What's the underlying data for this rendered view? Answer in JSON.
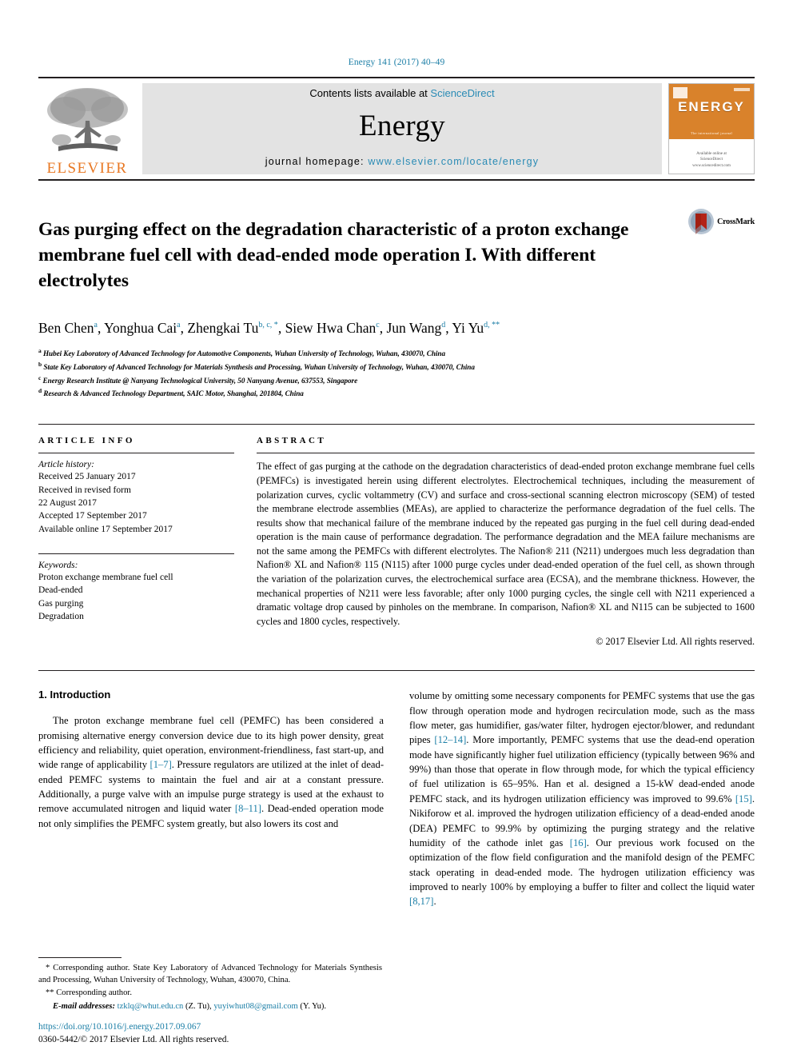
{
  "running_head": "Energy 141 (2017) 40–49",
  "masthead": {
    "publisher_name": "ELSEVIER",
    "contents_text": "Contents lists available at ",
    "sciencedirect": "ScienceDirect",
    "journal_title": "Energy",
    "homepage_label": "journal homepage: ",
    "homepage_url": "www.elsevier.com/locate/energy",
    "cover_title": "ENERGY",
    "cover_tagline": "The international journal",
    "cover_footer_1": "Available online at",
    "cover_footer_2": "ScienceDirect",
    "cover_footer_3": "www.sciencedirect.com",
    "link_color": "#2a8bb5",
    "brand_orange": "#e87722"
  },
  "article": {
    "title": "Gas purging effect on the degradation characteristic of a proton exchange membrane fuel cell with dead-ended mode operation I. With different electrolytes",
    "crossmark_label": "CrossMark",
    "authors": [
      {
        "name": "Ben Chen",
        "sup": "a",
        "sep": ", "
      },
      {
        "name": "Yonghua Cai",
        "sup": "a",
        "sep": ", "
      },
      {
        "name": "Zhengkai Tu",
        "sup": "b, c, *",
        "sep": ", "
      },
      {
        "name": "Siew Hwa Chan",
        "sup": "c",
        "sep": ", "
      },
      {
        "name": "Jun Wang",
        "sup": "d",
        "sep": ", "
      },
      {
        "name": "Yi Yu",
        "sup": "d, **",
        "sep": ""
      }
    ],
    "affiliations": [
      {
        "sup": "a",
        "text": "Hubei Key Laboratory of Advanced Technology for Automotive Components, Wuhan University of Technology, Wuhan, 430070, China"
      },
      {
        "sup": "b",
        "text": "State Key Laboratory of Advanced Technology for Materials Synthesis and Processing, Wuhan University of Technology, Wuhan, 430070, China"
      },
      {
        "sup": "c",
        "text": "Energy Research Institute @ Nanyang Technological University, 50 Nanyang Avenue, 637553, Singapore"
      },
      {
        "sup": "d",
        "text": "Research & Advanced Technology Department, SAIC Motor, Shanghai, 201804, China"
      }
    ]
  },
  "article_info": {
    "label": "ARTICLE INFO",
    "history_title": "Article history:",
    "history": [
      "Received 25 January 2017",
      "Received in revised form",
      "22 August 2017",
      "Accepted 17 September 2017",
      "Available online 17 September 2017"
    ],
    "keywords_title": "Keywords:",
    "keywords": [
      "Proton exchange membrane fuel cell",
      "Dead-ended",
      "Gas purging",
      "Degradation"
    ]
  },
  "abstract": {
    "label": "ABSTRACT",
    "text": "The effect of gas purging at the cathode on the degradation characteristics of dead-ended proton exchange membrane fuel cells (PEMFCs) is investigated herein using different electrolytes. Electrochemical techniques, including the measurement of polarization curves, cyclic voltammetry (CV) and surface and cross-sectional scanning electron microscopy (SEM) of tested the membrane electrode assemblies (MEAs), are applied to characterize the performance degradation of the fuel cells. The results show that mechanical failure of the membrane induced by the repeated gas purging in the fuel cell during dead-ended operation is the main cause of performance degradation. The performance degradation and the MEA failure mechanisms are not the same among the PEMFCs with different electrolytes. The Nafion® 211 (N211) undergoes much less degradation than Nafion® XL and Nafion® 115 (N115) after 1000 purge cycles under dead-ended operation of the fuel cell, as shown through the variation of the polarization curves, the electrochemical surface area (ECSA), and the membrane thickness. However, the mechanical properties of N211 were less favorable; after only 1000 purging cycles, the single cell with N211 experienced a dramatic voltage drop caused by pinholes on the membrane. In comparison, Nafion® XL and N115 can be subjected to 1600 cycles and 1800 cycles, respectively.",
    "copyright": "© 2017 Elsevier Ltd. All rights reserved."
  },
  "introduction": {
    "heading": "1. Introduction",
    "left_para_1": "The proton exchange membrane fuel cell (PEMFC) has been considered a promising alternative energy conversion device due to its high power density, great efficiency and reliability, quiet operation, environment-friendliness, fast start-up, and wide range of applicability ",
    "left_ref_1": "[1–7]",
    "left_para_2": ". Pressure regulators are utilized at the inlet of dead-ended PEMFC systems to maintain the fuel and air at a constant pressure. Additionally, a purge valve with an impulse purge strategy is used at the exhaust to remove accumulated nitrogen and liquid water ",
    "left_ref_2": "[8–11]",
    "left_para_3": ". Dead-ended operation mode not only simplifies the PEMFC system greatly, but also lowers its cost and",
    "right_para_1": "volume by omitting some necessary components for PEMFC systems that use the gas flow through operation mode and hydrogen recirculation mode, such as the mass flow meter, gas humidifier, gas/water filter, hydrogen ejector/blower, and redundant pipes ",
    "right_ref_1": "[12–14]",
    "right_para_2": ". More importantly, PEMFC systems that use the dead-end operation mode have significantly higher fuel utilization efficiency (typically between 96% and 99%) than those that operate in flow through mode, for which the typical efficiency of fuel utilization is 65–95%. Han et al. designed a 15-kW dead-ended anode PEMFC stack, and its hydrogen utilization efficiency was improved to 99.6% ",
    "right_ref_2": "[15]",
    "right_para_3": ". Nikiforow et al. improved the hydrogen utilization efficiency of a dead-ended anode (DEA) PEMFC to 99.9% by optimizing the purging strategy and the relative humidity of the cathode inlet gas ",
    "right_ref_3": "[16]",
    "right_para_4": ". Our previous work focused on the optimization of the flow field configuration and the manifold design of the PEMFC stack operating in dead-ended mode. The hydrogen utilization efficiency was improved to nearly 100% by employing a buffer to filter and collect the liquid water ",
    "right_ref_4": "[8,17]",
    "right_para_5": "."
  },
  "footnotes": {
    "corr_1_marker": "*",
    "corr_1": " Corresponding author. State Key Laboratory of Advanced Technology for Materials Synthesis and Processing, Wuhan University of Technology, Wuhan, 430070, China.",
    "corr_2_marker": "**",
    "corr_2": " Corresponding author.",
    "emails_label": "E-mail addresses:",
    "email_1": "tzklq@whut.edu.cn",
    "email_1_owner": "(Z. Tu)",
    "email_2": "yuyiwhut08@gmail.com",
    "email_2_owner": "(Y. Yu).",
    "doi": "https://doi.org/10.1016/j.energy.2017.09.067",
    "issn_line": "0360-5442/© 2017 Elsevier Ltd. All rights reserved."
  }
}
